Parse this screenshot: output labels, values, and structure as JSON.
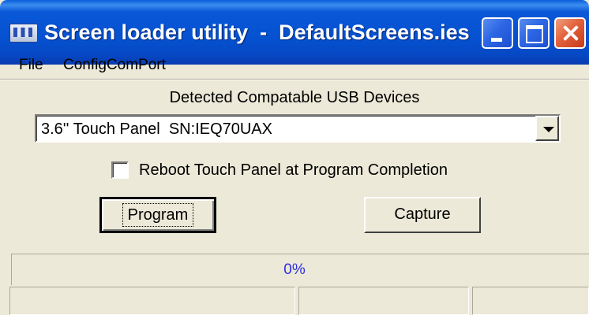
{
  "window": {
    "title": "Screen loader utility  -  DefaultScreens.ies",
    "icon": "app-screen-icon"
  },
  "menu": {
    "file": "File",
    "config": "ConfigComPort"
  },
  "devices": {
    "label": "Detected Compatable USB Devices",
    "selected": "3.6'' Touch Panel  SN:IEQ70UAX"
  },
  "options": {
    "reboot_label": "Reboot Touch Panel at Program Completion",
    "reboot_checked": false
  },
  "buttons": {
    "program": "Program",
    "capture": "Capture"
  },
  "progress": {
    "text": "0%",
    "value": 0
  },
  "colors": {
    "progress_text": "#2f2fe0",
    "titlebar": "#0551d0",
    "window_bg": "#ece9d8"
  }
}
